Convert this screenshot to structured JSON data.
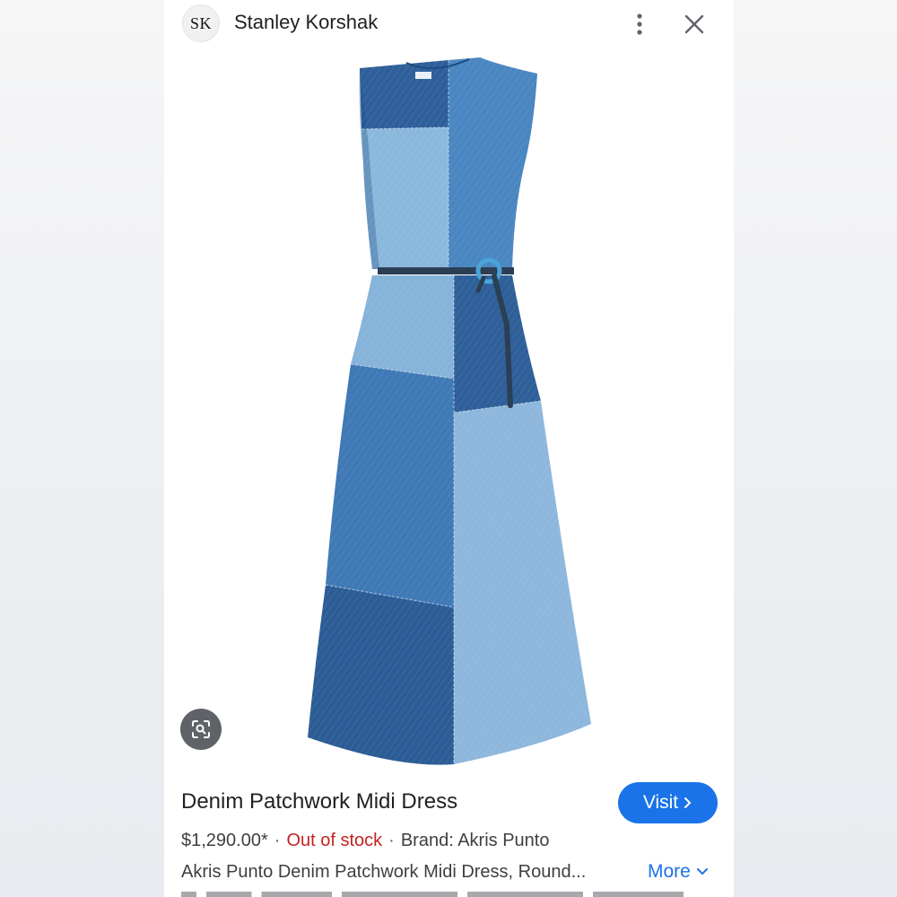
{
  "header": {
    "logo_text": "SK",
    "site_name": "Stanley Korshak"
  },
  "product": {
    "title": "Denim Patchwork Midi Dress",
    "price": "$1,290.00*",
    "separator": "·",
    "stock_status": "Out of stock",
    "brand": "Brand: Akris Punto",
    "description": "Akris Punto Denim Patchwork Midi Dress, Round...",
    "visit_label": "Visit",
    "more_label": "More"
  },
  "icons": {
    "menu": "more-vert-icon",
    "close": "close-icon",
    "lens": "lens-search-icon",
    "visit_arrow": "chevron-right-icon",
    "more_arrow": "chevron-down-icon"
  },
  "colors": {
    "accent": "#1a73e8",
    "out_of_stock": "#c5221f",
    "denim_dark": "#2a5b94",
    "denim_mid": "#3d7ab8",
    "denim_light": "#7fb0d8"
  }
}
